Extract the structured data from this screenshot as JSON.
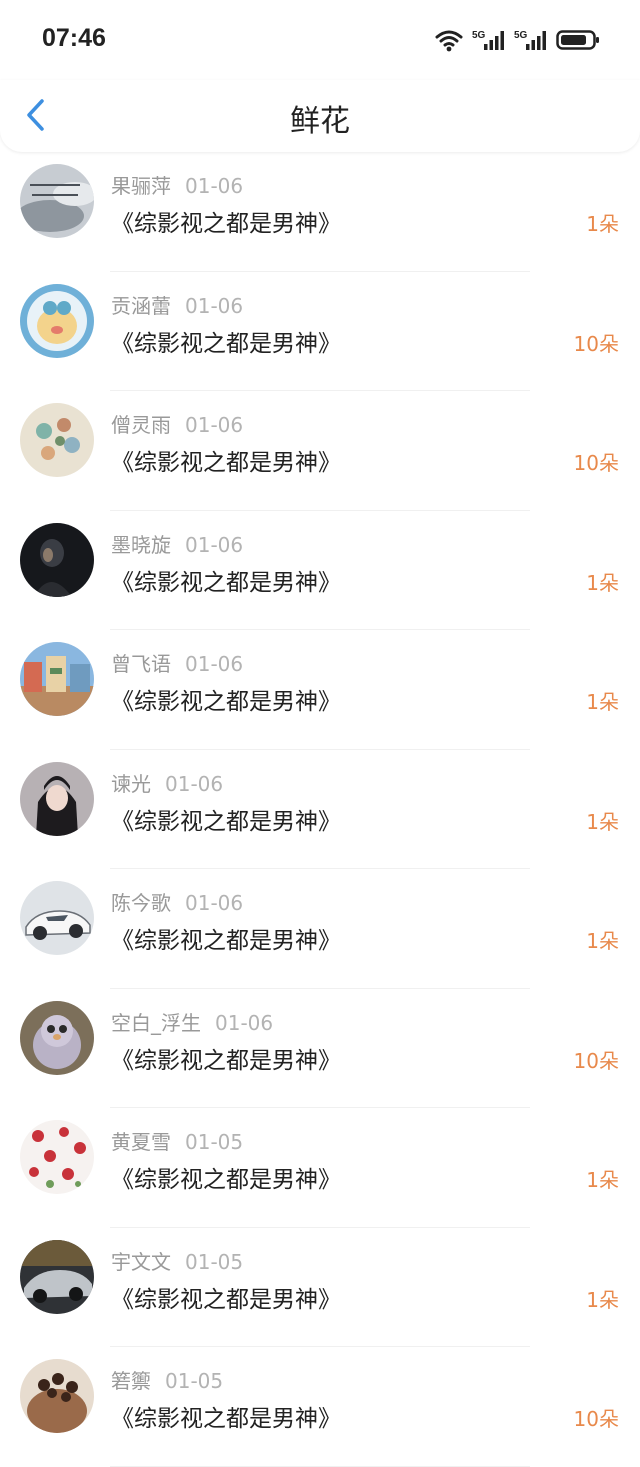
{
  "status_bar": {
    "time": "07:46",
    "icons": [
      "wifi-icon",
      "5g-signal-icon",
      "5g-signal-icon",
      "battery-icon"
    ],
    "network_label_1": "5G",
    "network_label_2": "5G"
  },
  "header": {
    "title": "鲜花",
    "back_icon": "chevron-left-icon"
  },
  "colors": {
    "accent_blue": "#3d8fe0",
    "count_orange": "#e8894b",
    "text_primary": "#222222",
    "text_secondary": "#999999"
  },
  "flowers": [
    {
      "user": "果骊萍",
      "date": "01-06",
      "book": "《综影视之都是男神》",
      "count": "1朵"
    },
    {
      "user": "贡涵蕾",
      "date": "01-06",
      "book": "《综影视之都是男神》",
      "count": "10朵"
    },
    {
      "user": "僧灵雨",
      "date": "01-06",
      "book": "《综影视之都是男神》",
      "count": "10朵"
    },
    {
      "user": "墨晓旋",
      "date": "01-06",
      "book": "《综影视之都是男神》",
      "count": "1朵"
    },
    {
      "user": "曾飞语",
      "date": "01-06",
      "book": "《综影视之都是男神》",
      "count": "1朵"
    },
    {
      "user": "谏光",
      "date": "01-06",
      "book": "《综影视之都是男神》",
      "count": "1朵"
    },
    {
      "user": "陈今歌",
      "date": "01-06",
      "book": "《综影视之都是男神》",
      "count": "1朵"
    },
    {
      "user": "空白_浮生",
      "date": "01-06",
      "book": "《综影视之都是男神》",
      "count": "10朵"
    },
    {
      "user": "黄夏雪",
      "date": "01-05",
      "book": "《综影视之都是男神》",
      "count": "1朵"
    },
    {
      "user": "宇文文",
      "date": "01-05",
      "book": "《综影视之都是男神》",
      "count": "1朵"
    },
    {
      "user": "箬籞",
      "date": "01-05",
      "book": "《综影视之都是男神》",
      "count": "10朵"
    }
  ]
}
